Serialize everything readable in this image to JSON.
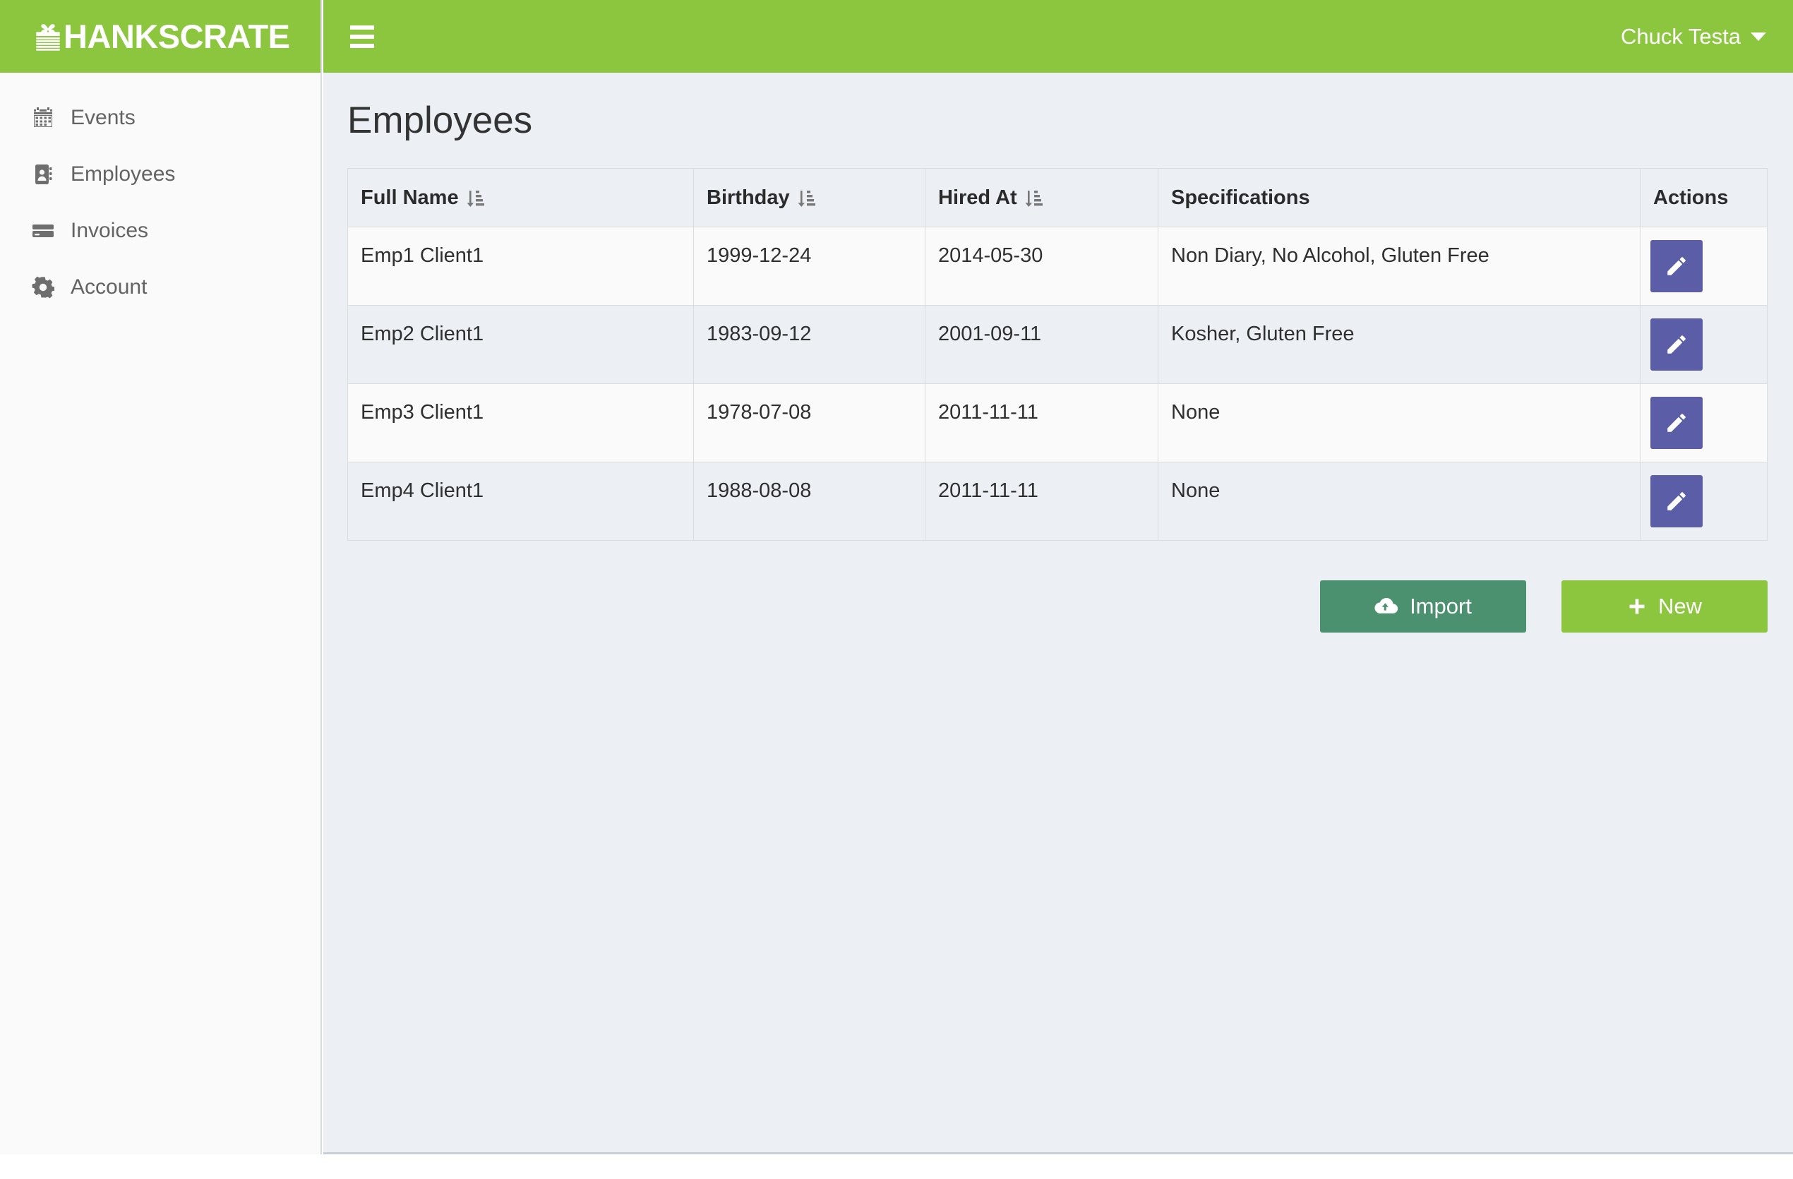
{
  "brand": {
    "icon": "gift-icon",
    "text": "HANKSCRATE"
  },
  "topbar": {
    "menu_icon": "hamburger-icon",
    "user_name": "Chuck Testa",
    "caret_icon": "caret-down-icon"
  },
  "sidebar": {
    "items": [
      {
        "label": "Events",
        "icon": "calendar-icon"
      },
      {
        "label": "Employees",
        "icon": "address-book-icon"
      },
      {
        "label": "Invoices",
        "icon": "credit-card-icon"
      },
      {
        "label": "Account",
        "icon": "gear-icon"
      }
    ]
  },
  "main": {
    "page_title": "Employees",
    "table": {
      "columns": [
        {
          "label": "Full Name",
          "sortable": true,
          "sort_icon": "sort-amount-down-icon"
        },
        {
          "label": "Birthday",
          "sortable": true,
          "sort_icon": "sort-amount-down-icon"
        },
        {
          "label": "Hired At",
          "sortable": true,
          "sort_icon": "sort-amount-down-icon"
        },
        {
          "label": "Specifications",
          "sortable": false,
          "sort_icon": ""
        },
        {
          "label": "Actions",
          "sortable": false,
          "sort_icon": ""
        }
      ],
      "rows": [
        {
          "full_name": "Emp1 Client1",
          "birthday": "1999-12-24",
          "hired_at": "2014-05-30",
          "specifications": "Non Diary, No Alcohol, Gluten Free",
          "action_icon": "pencil-icon"
        },
        {
          "full_name": "Emp2 Client1",
          "birthday": "1983-09-12",
          "hired_at": "2001-09-11",
          "specifications": "Kosher, Gluten Free",
          "action_icon": "pencil-icon"
        },
        {
          "full_name": "Emp3 Client1",
          "birthday": "1978-07-08",
          "hired_at": "2011-11-11",
          "specifications": "None",
          "action_icon": "pencil-icon"
        },
        {
          "full_name": "Emp4 Client1",
          "birthday": "1988-08-08",
          "hired_at": "2011-11-11",
          "specifications": "None",
          "action_icon": "pencil-icon"
        }
      ]
    },
    "buttons": {
      "import_label": "Import",
      "import_icon": "cloud-upload-icon",
      "new_label": "New",
      "new_icon": "plus-icon"
    }
  },
  "colors": {
    "brand_green": "#8cc63e",
    "import_green": "#4b9170",
    "edit_purple": "#5b5ea6",
    "page_background": "#ecf0f5",
    "sidebar_background": "#fafafa"
  }
}
